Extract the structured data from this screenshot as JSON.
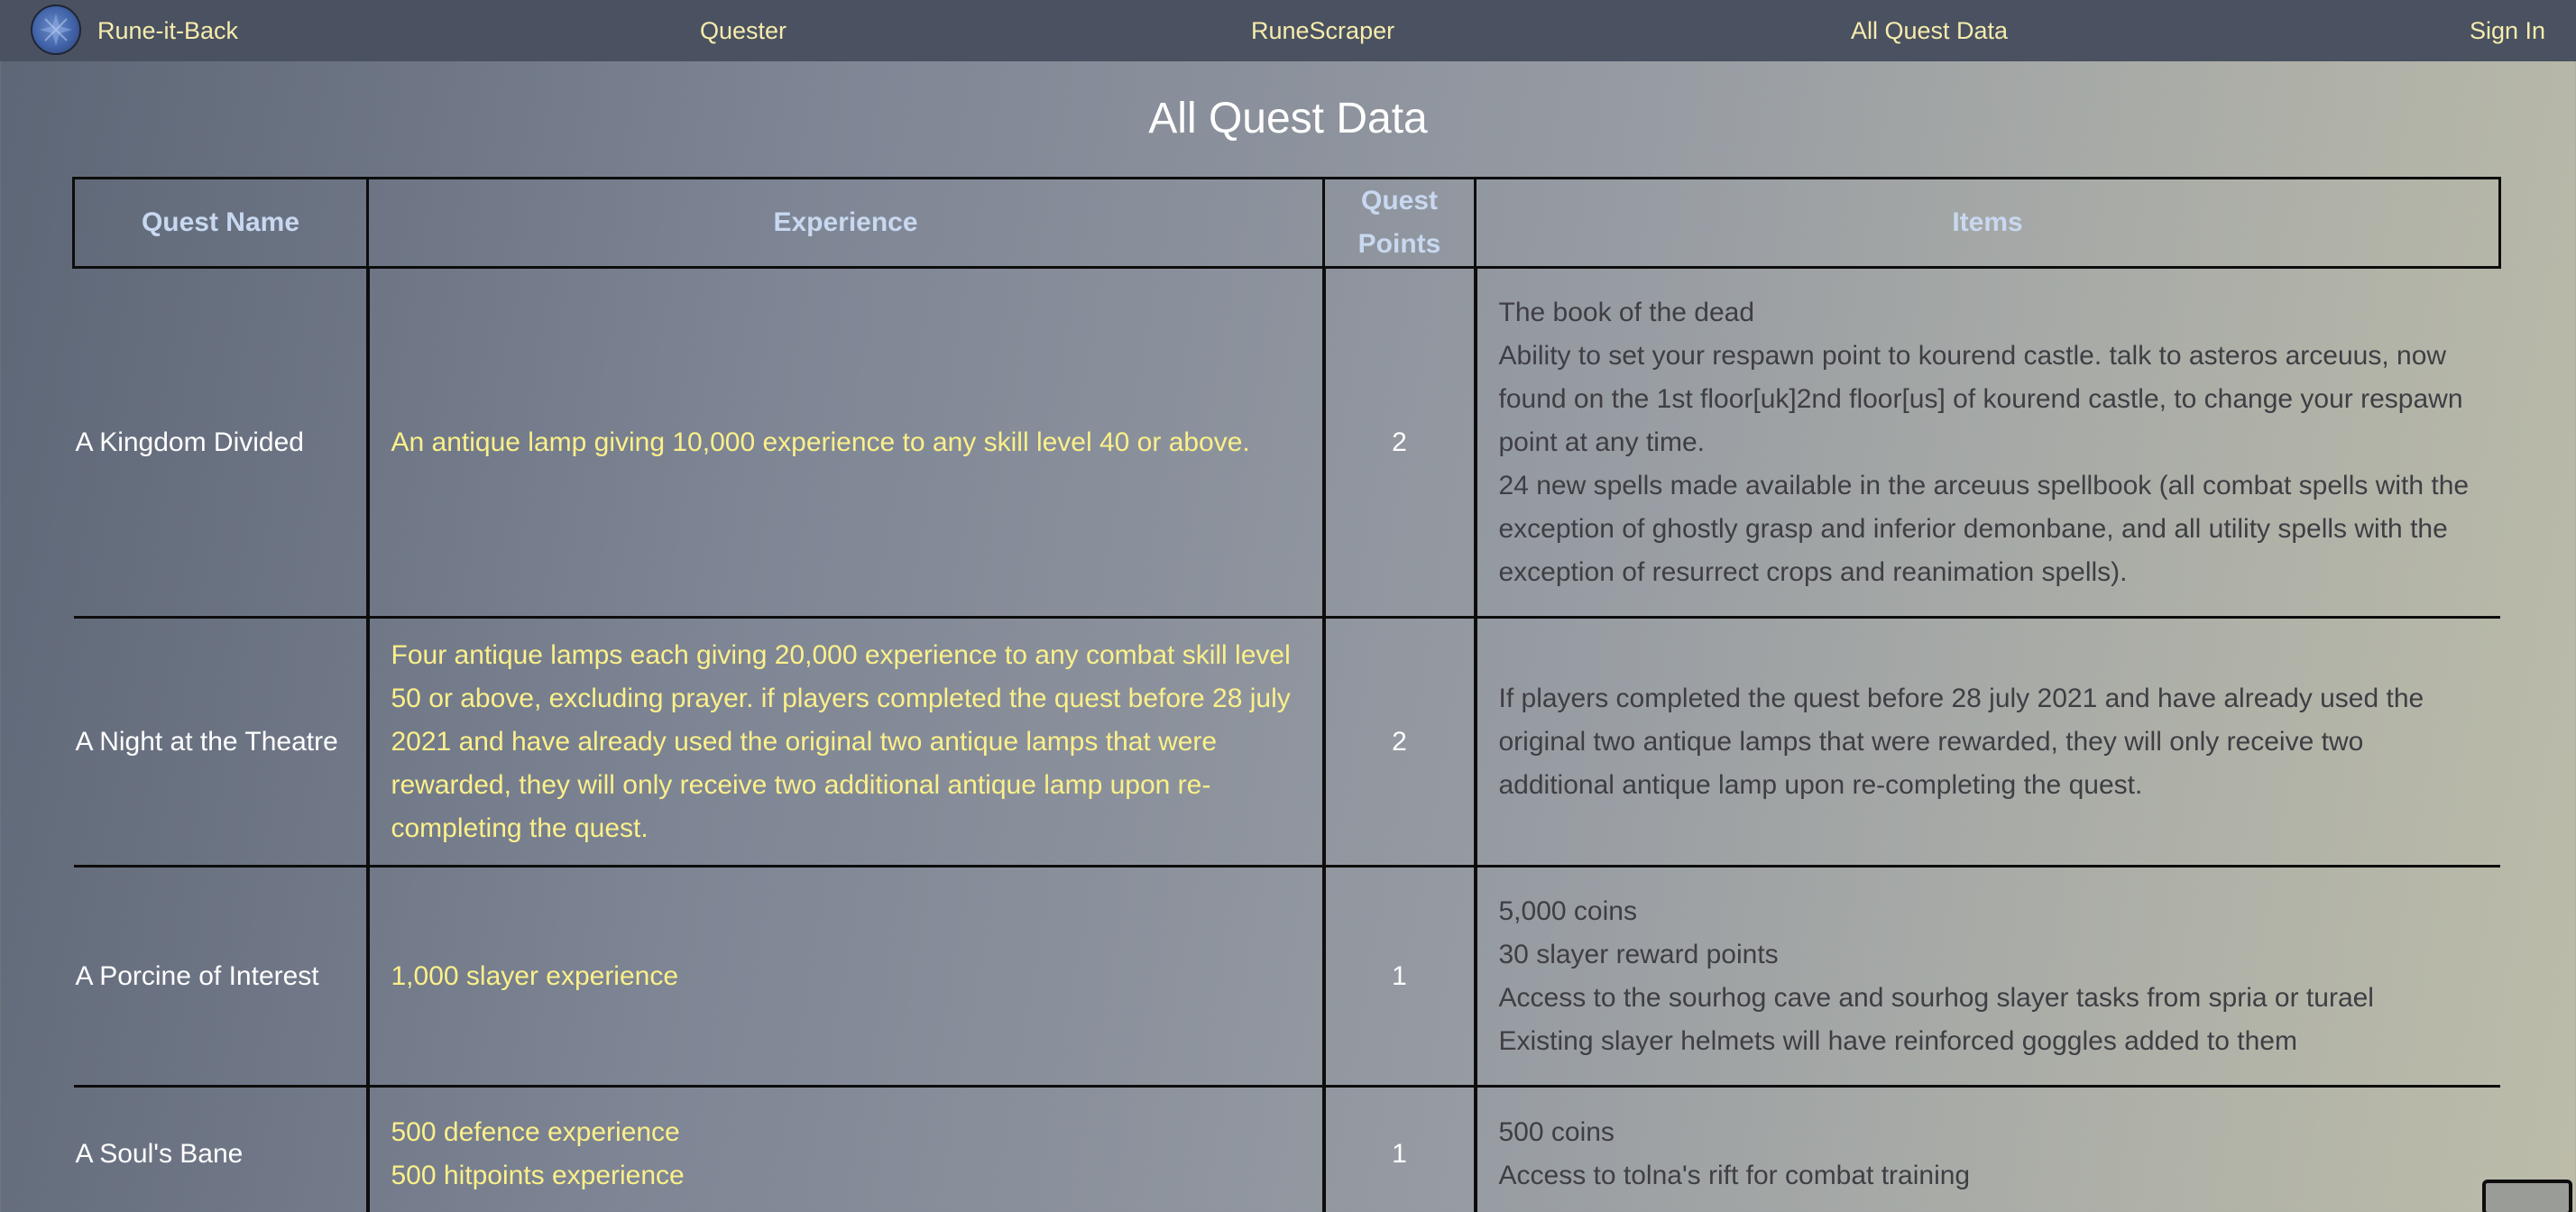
{
  "nav": {
    "brand": "Rune-it-Back",
    "links": [
      "Quester",
      "RuneScraper",
      "All Quest Data"
    ],
    "sign_in": "Sign In"
  },
  "page_title": "All Quest Data",
  "table": {
    "headers": {
      "name": "Quest Name",
      "experience": "Experience",
      "quest_points": "Quest Points",
      "items": "Items"
    },
    "rows": [
      {
        "name": "A Kingdom Divided",
        "experience": [
          "An antique lamp giving 10,000 experience to any skill level 40 or above."
        ],
        "quest_points": "2",
        "items": [
          "The book of the dead",
          "Ability to set your respawn point to kourend castle. talk to asteros arceuus, now found on the 1st floor[uk]2nd floor[us] of kourend castle, to change your respawn point at any time.",
          "24 new spells made available in the arceuus spellbook (all combat spells with the exception of ghostly grasp and inferior demonbane, and all utility spells with the exception of resurrect crops and reanimation spells)."
        ]
      },
      {
        "name": "A Night at the Theatre",
        "experience": [
          "Four antique lamps each giving 20,000 experience to any combat skill level 50 or above, excluding prayer. if players completed the quest before 28 july 2021 and have already used the original two antique lamps that were rewarded, they will only receive two additional antique lamp upon re-completing the quest."
        ],
        "quest_points": "2",
        "items": [
          "If players completed the quest before 28 july 2021 and have already used the original two antique lamps that were rewarded, they will only receive two additional antique lamp upon re-completing the quest."
        ]
      },
      {
        "name": "A Porcine of Interest",
        "experience": [
          "1,000 slayer experience"
        ],
        "quest_points": "1",
        "items": [
          "5,000 coins",
          "30 slayer reward points",
          "Access to the sourhog cave and sourhog slayer tasks from spria or turael",
          "Existing slayer helmets will have reinforced goggles added to them"
        ]
      },
      {
        "name": "A Soul's Bane",
        "experience": [
          "500 defence experience",
          "500 hitpoints experience"
        ],
        "quest_points": "1",
        "items": [
          "500 coins",
          "Access to tolna's rift for combat training"
        ]
      }
    ]
  }
}
